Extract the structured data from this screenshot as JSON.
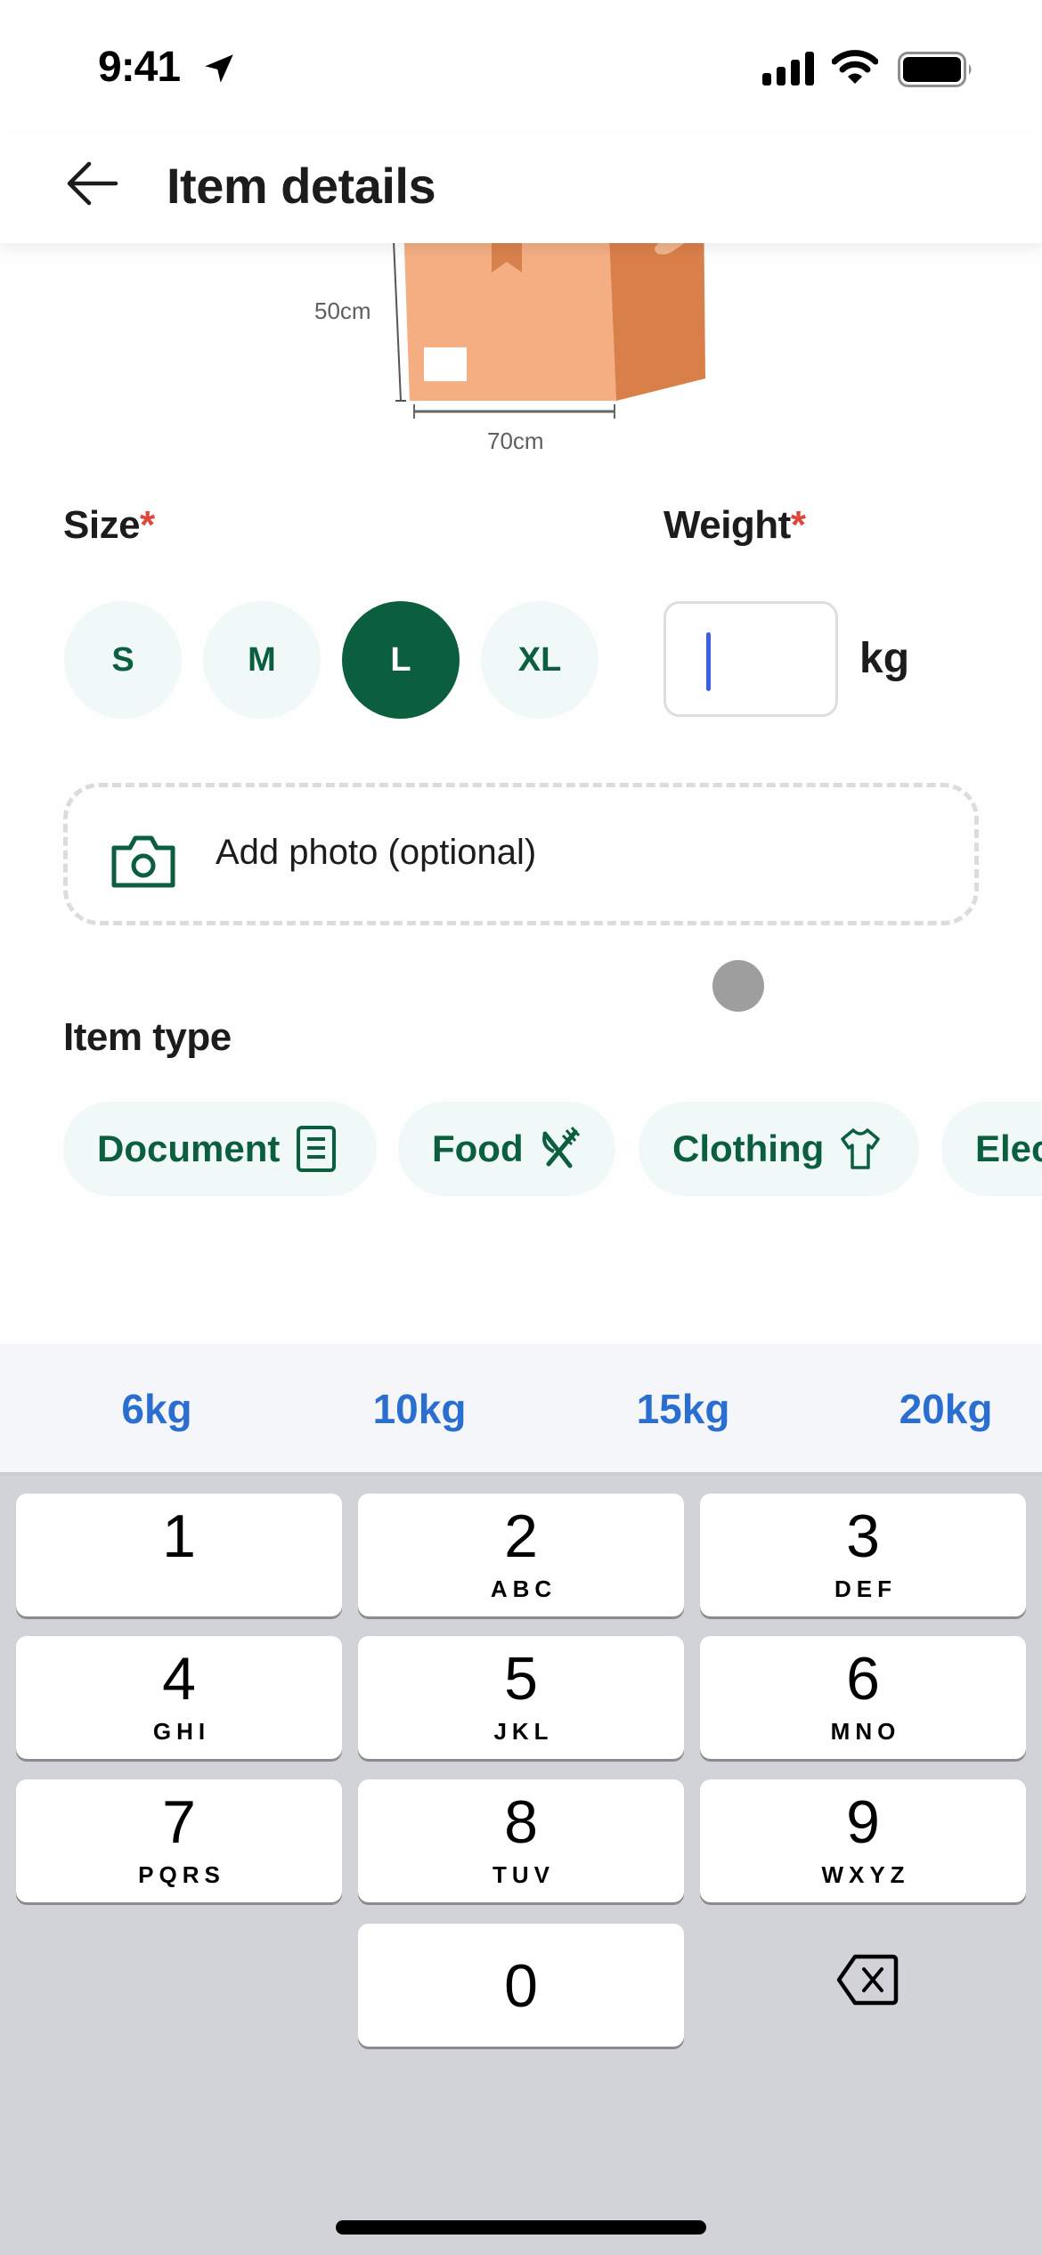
{
  "status_bar": {
    "time": "9:41",
    "icons": [
      "location-arrow-icon",
      "signal-icon",
      "wifi-icon",
      "battery-icon"
    ]
  },
  "header": {
    "back_icon": "arrow-left-icon",
    "title": "Item details"
  },
  "illustration": {
    "height_label": "50cm",
    "width_label": "70cm",
    "colors": {
      "front": "#f4ae82",
      "side": "#d97f4a",
      "tape": "#d9814e"
    }
  },
  "size": {
    "label": "Size",
    "required_mark": "*",
    "options": [
      {
        "label": "S",
        "selected": false
      },
      {
        "label": "M",
        "selected": false
      },
      {
        "label": "L",
        "selected": true
      },
      {
        "label": "XL",
        "selected": false
      }
    ],
    "selected": "L"
  },
  "weight": {
    "label": "Weight",
    "required_mark": "*",
    "value": "",
    "unit": "kg"
  },
  "photo": {
    "label": "Add photo (optional)",
    "icon": "camera-icon"
  },
  "item_type": {
    "label": "Item type",
    "chips": [
      {
        "label": "Document",
        "icon": "document-icon"
      },
      {
        "label": "Food",
        "icon": "utensils-icon"
      },
      {
        "label": "Clothing",
        "icon": "tshirt-icon"
      },
      {
        "label": "Elec",
        "icon": ""
      }
    ]
  },
  "weight_suggestions": [
    "6kg",
    "10kg",
    "15kg",
    "20kg"
  ],
  "keyboard": {
    "keys": [
      {
        "num": "1",
        "letters": ""
      },
      {
        "num": "2",
        "letters": "ABC"
      },
      {
        "num": "3",
        "letters": "DEF"
      },
      {
        "num": "4",
        "letters": "GHI"
      },
      {
        "num": "5",
        "letters": "JKL"
      },
      {
        "num": "6",
        "letters": "MNO"
      },
      {
        "num": "7",
        "letters": "PQRS"
      },
      {
        "num": "8",
        "letters": "TUV"
      },
      {
        "num": "9",
        "letters": "WXYZ"
      },
      {
        "num": "0",
        "letters": ""
      }
    ],
    "backspace_icon": "backspace-icon"
  },
  "colors": {
    "brand_green": "#0b5e3e",
    "chip_bg": "#f0f8f8",
    "required_red": "#e0453a",
    "suggestion_blue": "#2a6fd0",
    "caret_blue": "#3d5fe0"
  }
}
